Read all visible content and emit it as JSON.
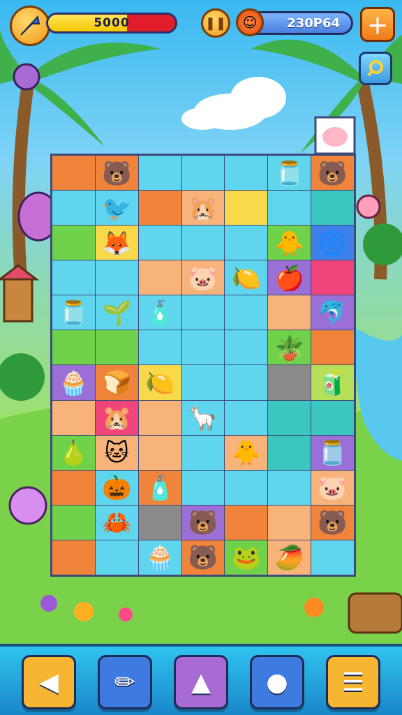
{
  "hud": {
    "score_text": "5000",
    "score_fill_fraction": 0.62,
    "coins_text": "230P64",
    "pause_icon": "pause-icon",
    "add_icon": "plus-icon",
    "search_icon": "magnifier-icon"
  },
  "colors": {
    "board_border": "#3d4a7a",
    "orange": "#f0843a",
    "cyan": "#5fd6ee",
    "green": "#6fd24a",
    "yellow": "#f7d94a",
    "purple": "#9a6fd6",
    "pink": "#f0457a",
    "blue": "#3f7fe8",
    "peach": "#f7b37a",
    "teal": "#3cc6c0",
    "lime": "#b6e05a",
    "gray": "#8a8a8a"
  },
  "board": {
    "rows": [
      [
        [
          "orange",
          ""
        ],
        [
          "orange",
          "🐻"
        ],
        [
          "cyan",
          ""
        ],
        [
          "cyan",
          ""
        ],
        [
          "cyan",
          ""
        ],
        [
          "cyan",
          "🫙"
        ],
        [
          "orange",
          "🐻"
        ]
      ],
      [
        [
          "cyan",
          ""
        ],
        [
          "cyan",
          "🐦"
        ],
        [
          "orange",
          ""
        ],
        [
          "peach",
          "🐹"
        ],
        [
          "yellow",
          ""
        ],
        [
          "cyan",
          ""
        ],
        [
          "teal",
          ""
        ]
      ],
      [
        [
          "green",
          ""
        ],
        [
          "yellow",
          "🦊"
        ],
        [
          "cyan",
          ""
        ],
        [
          "cyan",
          ""
        ],
        [
          "cyan",
          ""
        ],
        [
          "green",
          "🐥"
        ],
        [
          "blue",
          "🌀"
        ]
      ],
      [
        [
          "cyan",
          ""
        ],
        [
          "cyan",
          ""
        ],
        [
          "peach",
          ""
        ],
        [
          "peach",
          "🐷"
        ],
        [
          "cyan",
          "🍋"
        ],
        [
          "purple",
          "🍎"
        ],
        [
          "pink",
          ""
        ]
      ],
      [
        [
          "cyan",
          "🫙"
        ],
        [
          "cyan",
          "🌱"
        ],
        [
          "cyan",
          "🧴"
        ],
        [
          "cyan",
          ""
        ],
        [
          "cyan",
          ""
        ],
        [
          "peach",
          ""
        ],
        [
          "purple",
          "🐬"
        ]
      ],
      [
        [
          "green",
          ""
        ],
        [
          "green",
          ""
        ],
        [
          "cyan",
          ""
        ],
        [
          "cyan",
          ""
        ],
        [
          "cyan",
          ""
        ],
        [
          "green",
          "🪴"
        ],
        [
          "orange",
          ""
        ]
      ],
      [
        [
          "purple",
          "🧁"
        ],
        [
          "orange",
          "🍞"
        ],
        [
          "yellow",
          "🍋"
        ],
        [
          "cyan",
          ""
        ],
        [
          "cyan",
          ""
        ],
        [
          "gray",
          ""
        ],
        [
          "lime",
          "🧃"
        ]
      ],
      [
        [
          "peach",
          ""
        ],
        [
          "pink",
          "🐹"
        ],
        [
          "peach",
          ""
        ],
        [
          "cyan",
          "🦙"
        ],
        [
          "cyan",
          ""
        ],
        [
          "teal",
          ""
        ],
        [
          "teal",
          ""
        ]
      ],
      [
        [
          "green",
          "🍐"
        ],
        [
          "peach",
          "🐱"
        ],
        [
          "peach",
          ""
        ],
        [
          "cyan",
          ""
        ],
        [
          "peach",
          "🐥"
        ],
        [
          "teal",
          ""
        ],
        [
          "purple",
          "🫙"
        ]
      ],
      [
        [
          "orange",
          ""
        ],
        [
          "cyan",
          "🎃"
        ],
        [
          "orange",
          "🧴"
        ],
        [
          "cyan",
          ""
        ],
        [
          "cyan",
          ""
        ],
        [
          "cyan",
          ""
        ],
        [
          "peach",
          "🐷"
        ]
      ],
      [
        [
          "green",
          ""
        ],
        [
          "cyan",
          "🦀"
        ],
        [
          "gray",
          ""
        ],
        [
          "purple",
          "🐻"
        ],
        [
          "orange",
          ""
        ],
        [
          "peach",
          ""
        ],
        [
          "orange",
          "🐻"
        ]
      ],
      [
        [
          "orange",
          ""
        ],
        [
          "cyan",
          ""
        ],
        [
          "cyan",
          "🧁"
        ],
        [
          "orange",
          "🐻"
        ],
        [
          "green",
          "🐸"
        ],
        [
          "peach",
          "🥭"
        ],
        [
          "cyan",
          ""
        ]
      ]
    ]
  },
  "toolbar": {
    "items": [
      {
        "name": "back-tool-button",
        "icon": "back-arrow-icon",
        "glyph": "◀",
        "color": "#f7b632"
      },
      {
        "name": "pencil-tool-button",
        "icon": "pencil-icon",
        "glyph": "✏",
        "color": "#3e7be0"
      },
      {
        "name": "hint-tool-button",
        "icon": "triangle-hint-icon",
        "glyph": "▲",
        "color": "#a86bd6"
      },
      {
        "name": "ball-tool-button",
        "icon": "ball-icon",
        "glyph": "●",
        "color": "#3e7be0"
      },
      {
        "name": "menu-tool-button",
        "icon": "menu-icon",
        "glyph": "☰",
        "color": "#f7b632"
      }
    ]
  }
}
